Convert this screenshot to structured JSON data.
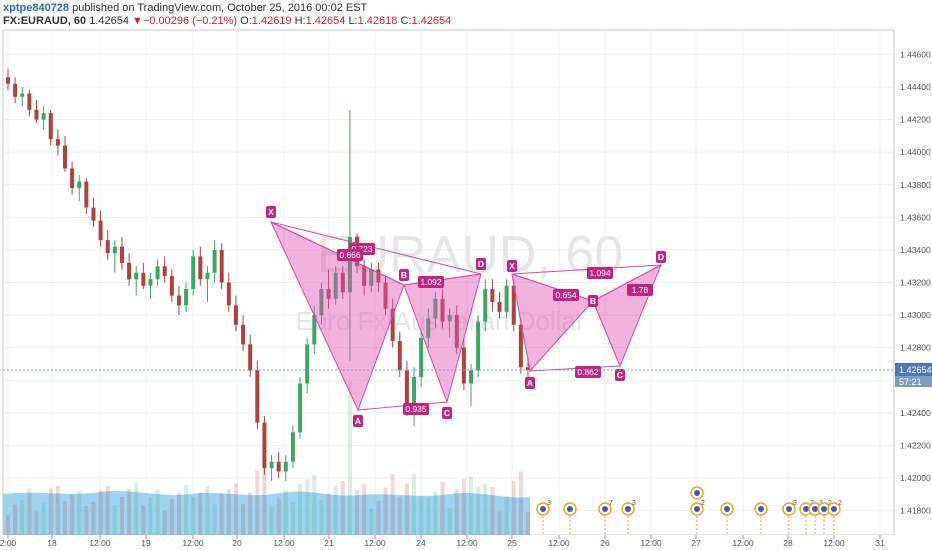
{
  "header": {
    "username": "xptpe840728",
    "published_text": " published on TradingView.com, October 25, 2016 00:02 EST",
    "symbol": "FX:EURAUD, 60",
    "last": "1.42654",
    "arrow": "▼",
    "change": "−0.00296 (−0.21%)",
    "o_label": "O:",
    "o_value": "1.42619",
    "h_label": "H:",
    "h_value": "1.42654",
    "l_label": "L:",
    "l_value": "1.42618",
    "c_label": "C:",
    "c_value": "1.42654"
  },
  "watermark": {
    "symbol": "EURAUD, 60",
    "name": "Euro Fx/Australian Dollar"
  },
  "price_axis": {
    "ticks": [
      "1.44600",
      "1.44400",
      "1.44200",
      "1.44000",
      "1.43800",
      "1.43600",
      "1.43400",
      "1.43200",
      "1.43000",
      "1.42800",
      "1.42600",
      "1.42400",
      "1.42200",
      "1.42000",
      "1.41800"
    ],
    "current_price": "1.42654",
    "countdown": "57:21"
  },
  "time_axis": {
    "ticks": [
      "2:00",
      "18",
      "12:00",
      "19",
      "12:00",
      "20",
      "12:00",
      "21",
      "12:00",
      "24",
      "12:00",
      "25",
      "12:00",
      "26",
      "12:00",
      "27",
      "12:00",
      "28",
      "12:00",
      "31"
    ]
  },
  "colors": {
    "bull": "#3aa862",
    "bear": "#b0413e",
    "pattern_fill": "#e055b3",
    "pattern_stroke": "#d44aa8",
    "label_bg": "#c2247f",
    "volume_area": "#7ec4ee"
  },
  "patterns": {
    "points": [
      "X",
      "A",
      "B",
      "C",
      "D",
      "X",
      "A",
      "B",
      "C",
      "D"
    ],
    "ratios": [
      "0.723",
      "0.666",
      "1.092",
      "0.935",
      "1.094",
      "0.654",
      "1.78",
      "0.862"
    ]
  },
  "events": {
    "counts": [
      "3",
      "",
      "7",
      "3",
      "2",
      "",
      "",
      "3",
      "2",
      "2",
      "2",
      "2"
    ]
  },
  "chart_data": {
    "type": "candlestick",
    "title": "FX:EURAUD, 60",
    "ylim": [
      1.4165,
      1.4475
    ],
    "y_ticks": [
      1.446,
      1.444,
      1.442,
      1.44,
      1.438,
      1.436,
      1.434,
      1.432,
      1.43,
      1.428,
      1.426,
      1.424,
      1.422,
      1.42,
      1.418
    ],
    "x_ticks": [
      "2:00",
      "18",
      "12:00",
      "19",
      "12:00",
      "20",
      "12:00",
      "21",
      "12:00",
      "24",
      "12:00",
      "25",
      "12:00",
      "26",
      "12:00",
      "27",
      "12:00",
      "28",
      "12:00",
      "31"
    ],
    "last_price": 1.42654,
    "bars": [
      [
        1.4446,
        1.4451,
        1.4438,
        1.4442
      ],
      [
        1.4442,
        1.4446,
        1.443,
        1.4434
      ],
      [
        1.4434,
        1.444,
        1.4428,
        1.4436
      ],
      [
        1.4436,
        1.4438,
        1.4422,
        1.4426
      ],
      [
        1.4426,
        1.4432,
        1.4418,
        1.442
      ],
      [
        1.442,
        1.4428,
        1.4414,
        1.4424
      ],
      [
        1.4424,
        1.4426,
        1.4404,
        1.4408
      ],
      [
        1.4408,
        1.4414,
        1.4398,
        1.4404
      ],
      [
        1.4404,
        1.441,
        1.4388,
        1.439
      ],
      [
        1.439,
        1.4394,
        1.4374,
        1.4378
      ],
      [
        1.4378,
        1.4386,
        1.437,
        1.4382
      ],
      [
        1.4382,
        1.4384,
        1.4362,
        1.4366
      ],
      [
        1.4366,
        1.4372,
        1.4354,
        1.4358
      ],
      [
        1.4358,
        1.4364,
        1.4342,
        1.4346
      ],
      [
        1.4346,
        1.4352,
        1.4334,
        1.4338
      ],
      [
        1.4338,
        1.4346,
        1.4326,
        1.4342
      ],
      [
        1.4342,
        1.4348,
        1.4328,
        1.4332
      ],
      [
        1.4332,
        1.4338,
        1.4318,
        1.4322
      ],
      [
        1.4322,
        1.433,
        1.4312,
        1.4326
      ],
      [
        1.4326,
        1.4332,
        1.4316,
        1.4318
      ],
      [
        1.4318,
        1.4326,
        1.431,
        1.4322
      ],
      [
        1.4322,
        1.4334,
        1.4318,
        1.433
      ],
      [
        1.433,
        1.4336,
        1.432,
        1.4324
      ],
      [
        1.4324,
        1.4328,
        1.4308,
        1.4312
      ],
      [
        1.4312,
        1.4318,
        1.43,
        1.4306
      ],
      [
        1.4306,
        1.432,
        1.4302,
        1.4316
      ],
      [
        1.4316,
        1.434,
        1.4312,
        1.4336
      ],
      [
        1.4336,
        1.4342,
        1.4318,
        1.4322
      ],
      [
        1.4322,
        1.433,
        1.4308,
        1.4326
      ],
      [
        1.4326,
        1.4346,
        1.432,
        1.434
      ],
      [
        1.434,
        1.4344,
        1.4316,
        1.432
      ],
      [
        1.432,
        1.4326,
        1.4302,
        1.4306
      ],
      [
        1.4306,
        1.4312,
        1.429,
        1.4294
      ],
      [
        1.4294,
        1.43,
        1.4278,
        1.4282
      ],
      [
        1.4282,
        1.4288,
        1.4262,
        1.4266
      ],
      [
        1.4266,
        1.4272,
        1.423,
        1.4234
      ],
      [
        1.4234,
        1.4238,
        1.4202,
        1.4206
      ],
      [
        1.4206,
        1.4214,
        1.4198,
        1.421
      ],
      [
        1.421,
        1.4216,
        1.42,
        1.4204
      ],
      [
        1.4204,
        1.4214,
        1.4198,
        1.421
      ],
      [
        1.421,
        1.4232,
        1.4206,
        1.4228
      ],
      [
        1.4228,
        1.4262,
        1.4224,
        1.4258
      ],
      [
        1.4258,
        1.4286,
        1.4252,
        1.4282
      ],
      [
        1.4282,
        1.4306,
        1.4276,
        1.43
      ],
      [
        1.43,
        1.432,
        1.4294,
        1.4316
      ],
      [
        1.4316,
        1.4328,
        1.4304,
        1.431
      ],
      [
        1.431,
        1.433,
        1.4306,
        1.4326
      ],
      [
        1.4326,
        1.433,
        1.431,
        1.4314
      ],
      [
        1.4314,
        1.4426,
        1.4272,
        1.4348
      ],
      [
        1.4348,
        1.435,
        1.4326,
        1.433
      ],
      [
        1.433,
        1.4334,
        1.4312,
        1.4318
      ],
      [
        1.4318,
        1.4332,
        1.4314,
        1.4328
      ],
      [
        1.4328,
        1.4332,
        1.4314,
        1.432
      ],
      [
        1.432,
        1.4324,
        1.43,
        1.4304
      ],
      [
        1.4304,
        1.431,
        1.428,
        1.4284
      ],
      [
        1.4284,
        1.429,
        1.4262,
        1.4266
      ],
      [
        1.4266,
        1.4272,
        1.4238,
        1.4242
      ],
      [
        1.4242,
        1.4268,
        1.4232,
        1.4262
      ],
      [
        1.4262,
        1.429,
        1.4256,
        1.4286
      ],
      [
        1.4286,
        1.4304,
        1.428,
        1.4298
      ],
      [
        1.4298,
        1.4314,
        1.4292,
        1.431
      ],
      [
        1.431,
        1.4316,
        1.4292,
        1.4296
      ],
      [
        1.4296,
        1.4304,
        1.4286,
        1.43
      ],
      [
        1.43,
        1.4306,
        1.4276,
        1.428
      ],
      [
        1.428,
        1.4286,
        1.4254,
        1.4258
      ],
      [
        1.4258,
        1.427,
        1.4244,
        1.4266
      ],
      [
        1.4266,
        1.43,
        1.4262,
        1.4296
      ],
      [
        1.4296,
        1.4322,
        1.429,
        1.4316
      ],
      [
        1.4316,
        1.4322,
        1.4302,
        1.4308
      ],
      [
        1.4308,
        1.4314,
        1.4298,
        1.4302
      ],
      [
        1.4302,
        1.4322,
        1.4298,
        1.4318
      ],
      [
        1.4318,
        1.4322,
        1.429,
        1.4294
      ],
      [
        1.4294,
        1.4298,
        1.4264,
        1.4268
      ],
      [
        1.4268,
        1.4274,
        1.4262,
        1.4266
      ]
    ]
  }
}
